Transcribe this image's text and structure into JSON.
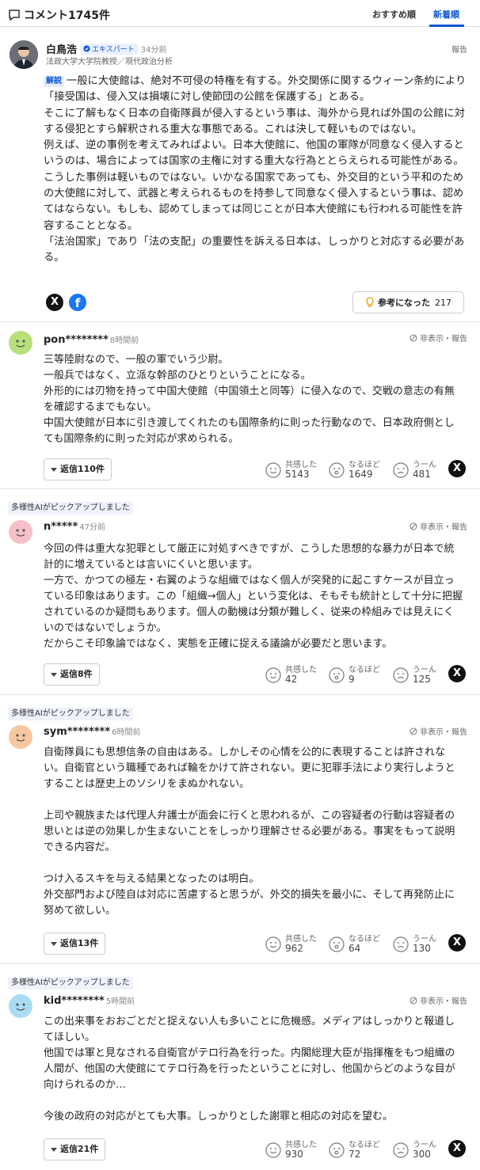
{
  "header": {
    "title": "コメント1745件",
    "sort_recommended": "おすすめ順",
    "sort_newest": "新着順"
  },
  "expert": {
    "name": "白鳥浩",
    "badge": "エキスパート",
    "time": "34分前",
    "title": "法政大学大学院教授／現代政治分析",
    "report": "報告",
    "tag": "解説",
    "paragraphs": [
      "一般に大使館は、絶対不可侵の特権を有する。外交関係に関するウィーン条約により「接受国は、侵入又は損壊に対し使節団の公館を保護する」とある。",
      "そこに了解もなく日本の自衛隊員が侵入するという事は、海外から見れば外国の公館に対する侵犯とすら解釈される重大な事態である。これは決して軽いものではない。",
      "例えば、逆の事例を考えてみればよい。日本大使館に、他国の軍隊が同意なく侵入するというのは、場合によっては国家の主権に対する重大な行為ととらえられる可能性がある。",
      "こうした事例は軽いものではない。いかなる国家であっても、外交目的という平和のための大使館に対して、武器と考えられるものを持参して同意なく侵入するという事は、認めてはならない。もしも、認めてしまっては同じことが日本大使館にも行われる可能性を許容することとなる。",
      "「法治国家」であり「法の支配」の重要性を訴える日本は、しっかりと対応する必要がある。"
    ],
    "helpful_label": "参考になった",
    "helpful_count": "217"
  },
  "comments": [
    {
      "pickup": "",
      "user": "pon********",
      "time": "8時間前",
      "controls": "非表示・報告",
      "lines": [
        "三等陸尉なので、一般の軍でいう少尉。",
        "一般兵ではなく、立派な幹部のひとりということになる。",
        "外形的には刃物を持って中国大使館（中国領土と同等）に侵入なので、交戦の意志の有無を確認するまでもない。",
        "中国大使館が日本に引き渡してくれたのも国際条約に則った行動なので、日本政府側としても国際条約に則った対応が求められる。"
      ],
      "reply": "返信110件",
      "reactions": [
        {
          "label": "共感した",
          "count": "5143"
        },
        {
          "label": "なるほど",
          "count": "1649"
        },
        {
          "label": "うーん",
          "count": "481"
        }
      ]
    },
    {
      "pickup": "多様性AIがピックアップしました",
      "user": "n*****",
      "time": "47分前",
      "controls": "非表示・報告",
      "lines": [
        "今回の件は重大な犯罪として厳正に対処すべきですが、こうした思想的な暴力が日本で統計的に増えているとは言いにくいと思います。",
        "一方で、かつての極左・右翼のような組織ではなく個人が突発的に起こすケースが目立っている印象はあります。この「組織→個人」という変化は、そもそも統計として十分に把握されているのか疑問もあります。個人の動機は分類が難しく、従来の枠組みでは見えにくいのではないでしょうか。",
        "だからこそ印象論ではなく、実態を正確に捉える議論が必要だと思います。"
      ],
      "reply": "返信8件",
      "reactions": [
        {
          "label": "共感した",
          "count": "42"
        },
        {
          "label": "なるほど",
          "count": "9"
        },
        {
          "label": "うーん",
          "count": "125"
        }
      ]
    },
    {
      "pickup": "多様性AIがピックアップしました",
      "user": "sym********",
      "time": "6時間前",
      "controls": "非表示・報告",
      "lines": [
        "自衛隊員にも思想信条の自由はある。しかしその心情を公的に表現することは許されない。自衛官という職種であれば輪をかけて許されない。更に犯罪手法により実行しようとすることは歴史上のソシリをまぬかれない。",
        "",
        "上司や親族または代理人弁護士が面会に行くと思われるが、この容疑者の行動は容疑者の思いとは逆の効果しか生まないことをしっかり理解させる必要がある。事実をもって説明できる内容だ。",
        "",
        "つけ入るスキを与える結果となったのは明白。",
        "外交部門および陸自は対応に苦慮すると思うが、外交的損失を最小に、そして再発防止に努めて欲しい。"
      ],
      "reply": "返信13件",
      "reactions": [
        {
          "label": "共感した",
          "count": "962"
        },
        {
          "label": "なるほど",
          "count": "64"
        },
        {
          "label": "うーん",
          "count": "130"
        }
      ]
    },
    {
      "pickup": "多様性AIがピックアップしました",
      "user": "kid********",
      "time": "5時間前",
      "controls": "非表示・報告",
      "lines": [
        "この出来事をおおごとだと捉えない人も多いことに危機感。メディアはしっかりと報道してほしい。",
        "他国では軍と見なされる自衛官がテロ行為を行った。内閣総理大臣が指揮権をもつ組織の人間が、他国の大使館にてテロ行為を行ったということに対し、他国からどのような目が向けられるのか…",
        "",
        "今後の政府の対応がとても大事。しっかりとした謝罪と相応の対応を望む。"
      ],
      "reply": "返信21件",
      "reactions": [
        {
          "label": "共感した",
          "count": "930"
        },
        {
          "label": "なるほど",
          "count": "72"
        },
        {
          "label": "うーん",
          "count": "300"
        }
      ]
    }
  ],
  "colors": {
    "accent": "#0a57d0",
    "tag_bg": "#e4eefb",
    "avatar1": "#b7e07a",
    "avatar2": "#f6c0c6",
    "avatar3": "#f7c79f",
    "avatar4": "#a9dcf2"
  },
  "icons": [
    "comment-icon",
    "x-share-icon",
    "facebook-share-icon",
    "lightbulb-icon",
    "hide-icon",
    "empathy-face-icon",
    "surprised-face-icon",
    "hmm-face-icon"
  ]
}
